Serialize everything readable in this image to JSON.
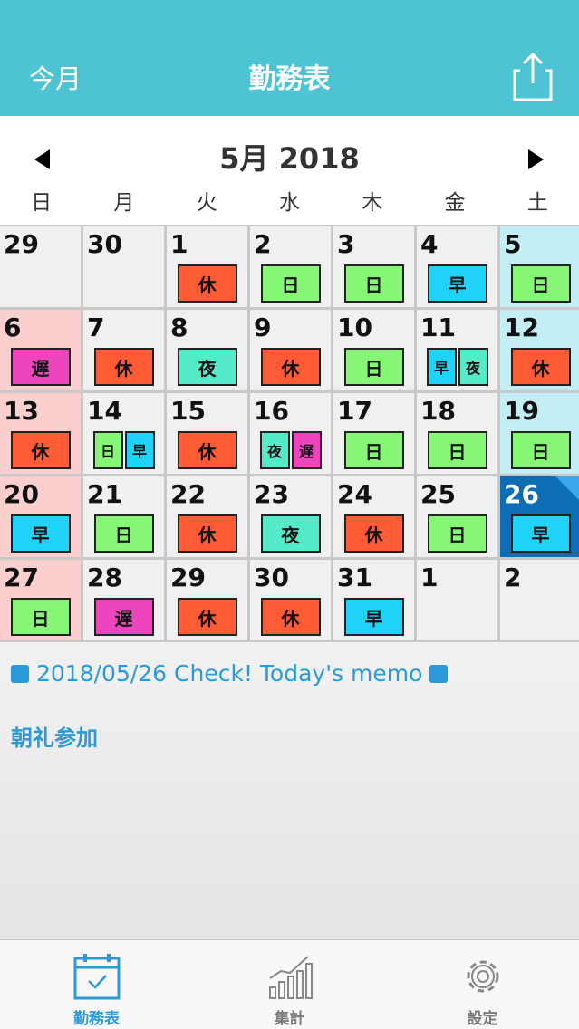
{
  "nav": {
    "today_label": "今月",
    "title": "勤務表",
    "share_icon": "share-icon"
  },
  "month": {
    "label": "5月 2018"
  },
  "weekdays": [
    "日",
    "月",
    "火",
    "水",
    "木",
    "金",
    "土"
  ],
  "calendar": {
    "weeks": [
      [
        {
          "day": "29",
          "type": "out",
          "shifts": []
        },
        {
          "day": "30",
          "type": "out",
          "shifts": []
        },
        {
          "day": "1",
          "type": "",
          "shifts": [
            "休"
          ]
        },
        {
          "day": "2",
          "type": "",
          "shifts": [
            "日"
          ]
        },
        {
          "day": "3",
          "type": "",
          "shifts": [
            "日"
          ]
        },
        {
          "day": "4",
          "type": "",
          "shifts": [
            "早"
          ]
        },
        {
          "day": "5",
          "type": "sat",
          "shifts": [
            "日"
          ]
        }
      ],
      [
        {
          "day": "6",
          "type": "sun",
          "shifts": [
            "遅"
          ]
        },
        {
          "day": "7",
          "type": "",
          "shifts": [
            "休"
          ]
        },
        {
          "day": "8",
          "type": "",
          "shifts": [
            "夜"
          ]
        },
        {
          "day": "9",
          "type": "",
          "shifts": [
            "休"
          ]
        },
        {
          "day": "10",
          "type": "",
          "shifts": [
            "日"
          ]
        },
        {
          "day": "11",
          "type": "",
          "shifts": [
            "早",
            "夜"
          ]
        },
        {
          "day": "12",
          "type": "sat",
          "shifts": [
            "休"
          ]
        }
      ],
      [
        {
          "day": "13",
          "type": "sun",
          "shifts": [
            "休"
          ]
        },
        {
          "day": "14",
          "type": "",
          "shifts": [
            "日",
            "早"
          ]
        },
        {
          "day": "15",
          "type": "",
          "shifts": [
            "休"
          ]
        },
        {
          "day": "16",
          "type": "",
          "shifts": [
            "夜",
            "遅"
          ]
        },
        {
          "day": "17",
          "type": "",
          "shifts": [
            "日"
          ]
        },
        {
          "day": "18",
          "type": "",
          "shifts": [
            "日"
          ]
        },
        {
          "day": "19",
          "type": "sat",
          "shifts": [
            "日"
          ]
        }
      ],
      [
        {
          "day": "20",
          "type": "sun",
          "shifts": [
            "早"
          ]
        },
        {
          "day": "21",
          "type": "",
          "shifts": [
            "日"
          ]
        },
        {
          "day": "22",
          "type": "",
          "shifts": [
            "休"
          ]
        },
        {
          "day": "23",
          "type": "",
          "shifts": [
            "夜"
          ]
        },
        {
          "day": "24",
          "type": "",
          "shifts": [
            "休"
          ]
        },
        {
          "day": "25",
          "type": "",
          "shifts": [
            "日"
          ]
        },
        {
          "day": "26",
          "type": "sel",
          "shifts": [
            "早"
          ]
        }
      ],
      [
        {
          "day": "27",
          "type": "sun",
          "shifts": [
            "日"
          ]
        },
        {
          "day": "28",
          "type": "",
          "shifts": [
            "遅"
          ]
        },
        {
          "day": "29",
          "type": "",
          "shifts": [
            "休"
          ]
        },
        {
          "day": "30",
          "type": "",
          "shifts": [
            "休"
          ]
        },
        {
          "day": "31",
          "type": "",
          "shifts": [
            "早"
          ]
        },
        {
          "day": "1",
          "type": "out",
          "shifts": []
        },
        {
          "day": "2",
          "type": "out",
          "shifts": []
        }
      ]
    ]
  },
  "shift_colors": {
    "休": "#FF5B35",
    "日": "#85F774",
    "早": "#1ED3F7",
    "夜": "#55EBC9",
    "遅": "#EE44BE"
  },
  "memo": {
    "header": "2018/05/26 Check! Today's memo",
    "text": "朝礼参加"
  },
  "tabs": [
    {
      "label": "勤務表",
      "icon": "calendar-icon",
      "active": true
    },
    {
      "label": "集計",
      "icon": "chart-icon",
      "active": false
    },
    {
      "label": "設定",
      "icon": "gear-icon",
      "active": false
    }
  ],
  "colors": {
    "accent": "#4DC3D4",
    "memo_blue": "#2B9AD8",
    "selected": "#0D6DB5"
  }
}
